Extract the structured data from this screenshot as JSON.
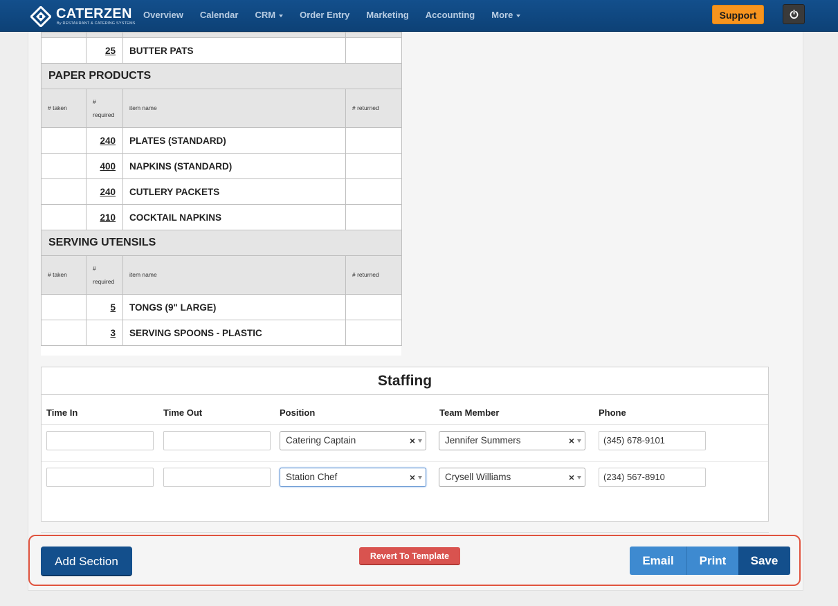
{
  "brand": {
    "name": "CATERZEN",
    "tagline": "By RESTAURANT & CATERING SYSTEMS"
  },
  "nav": {
    "items": [
      {
        "label": "Overview",
        "dropdown": false
      },
      {
        "label": "Calendar",
        "dropdown": false
      },
      {
        "label": "CRM",
        "dropdown": true
      },
      {
        "label": "Order Entry",
        "dropdown": false
      },
      {
        "label": "Marketing",
        "dropdown": false
      },
      {
        "label": "Accounting",
        "dropdown": false
      },
      {
        "label": "More",
        "dropdown": true
      }
    ],
    "support_label": "Support"
  },
  "supply": {
    "top_row": {
      "required": "25",
      "name": "BUTTER PATS"
    },
    "columns": {
      "taken": "# taken",
      "required_line1": "#",
      "required_line2": "required",
      "name": "item name",
      "returned": "# returned"
    },
    "sections": [
      {
        "title": "PAPER PRODUCTS",
        "items": [
          {
            "required": "240",
            "name": "PLATES (STANDARD)"
          },
          {
            "required": "400",
            "name": "NAPKINS (STANDARD)"
          },
          {
            "required": "240",
            "name": "CUTLERY PACKETS"
          },
          {
            "required": "210",
            "name": "COCKTAIL NAPKINS"
          }
        ]
      },
      {
        "title": "SERVING UTENSILS",
        "items": [
          {
            "required": "5",
            "name": "TONGS (9\" LARGE)"
          },
          {
            "required": "3",
            "name": "SERVING SPOONS - PLASTIC"
          }
        ]
      }
    ]
  },
  "staffing": {
    "title": "Staffing",
    "headers": {
      "time_in": "Time In",
      "time_out": "Time Out",
      "position": "Position",
      "team_member": "Team Member",
      "phone": "Phone"
    },
    "rows": [
      {
        "time_in": "",
        "time_out": "",
        "position": "Catering Captain",
        "team_member": "Jennifer Summers",
        "phone": "(345) 678-9101"
      },
      {
        "time_in": "",
        "time_out": "",
        "position": "Station Chef",
        "team_member": "Crysell Williams",
        "phone": "(234) 567-8910"
      }
    ]
  },
  "actions": {
    "add_section": "Add Section",
    "revert": "Revert To Template",
    "email": "Email",
    "print": "Print",
    "save": "Save"
  },
  "colors": {
    "nav": "#134f8c",
    "support": "#f7941e",
    "revert": "#d9534f",
    "highlight": "#e0533e"
  }
}
